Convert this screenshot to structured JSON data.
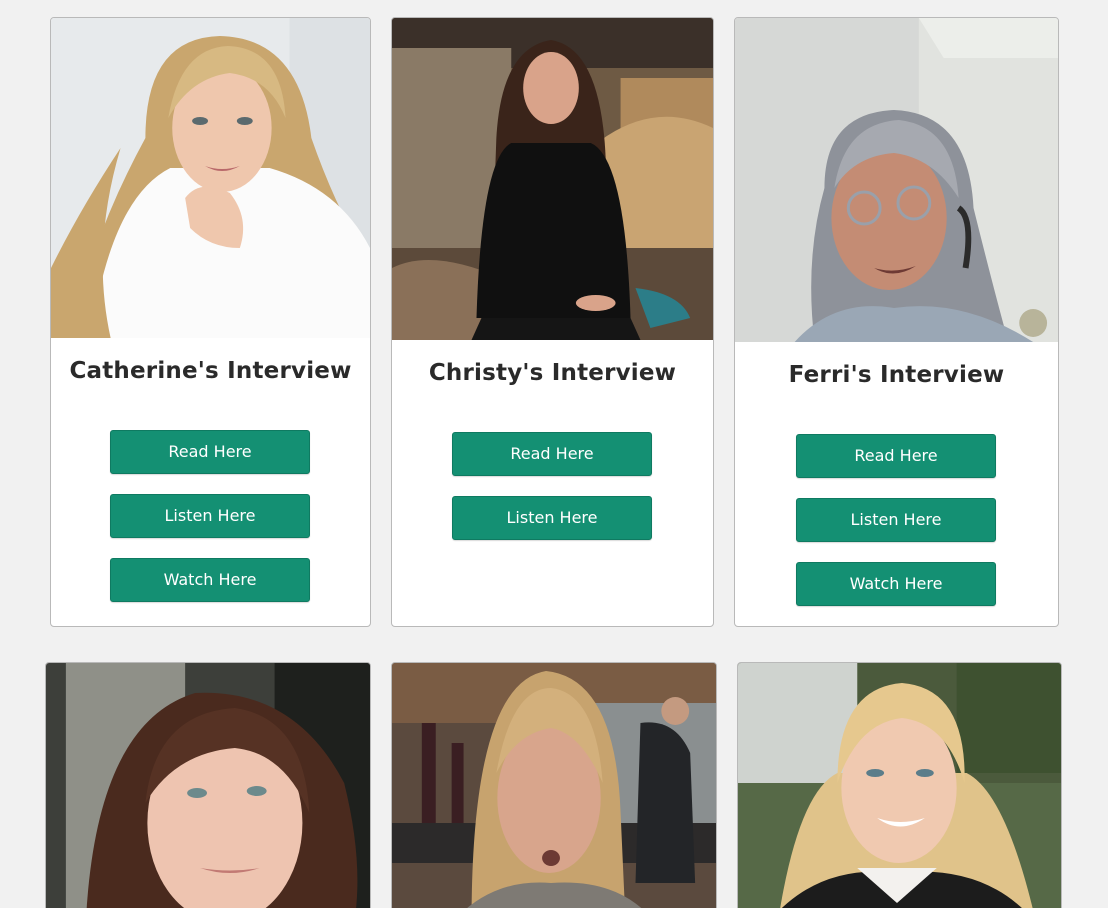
{
  "cards": [
    {
      "title": "Catherine's Interview",
      "buttons": [
        "Read Here",
        "Listen Here",
        "Watch Here"
      ]
    },
    {
      "title": "Christy's Interview",
      "buttons": [
        "Read Here",
        "Listen Here"
      ]
    },
    {
      "title": "Ferri's Interview",
      "buttons": [
        "Read Here",
        "Listen Here",
        "Watch Here"
      ]
    }
  ],
  "colors": {
    "page_background": "#f1f1f1",
    "button": "#149073",
    "button_text": "#ffffff",
    "title_text": "#2a2a2a"
  }
}
